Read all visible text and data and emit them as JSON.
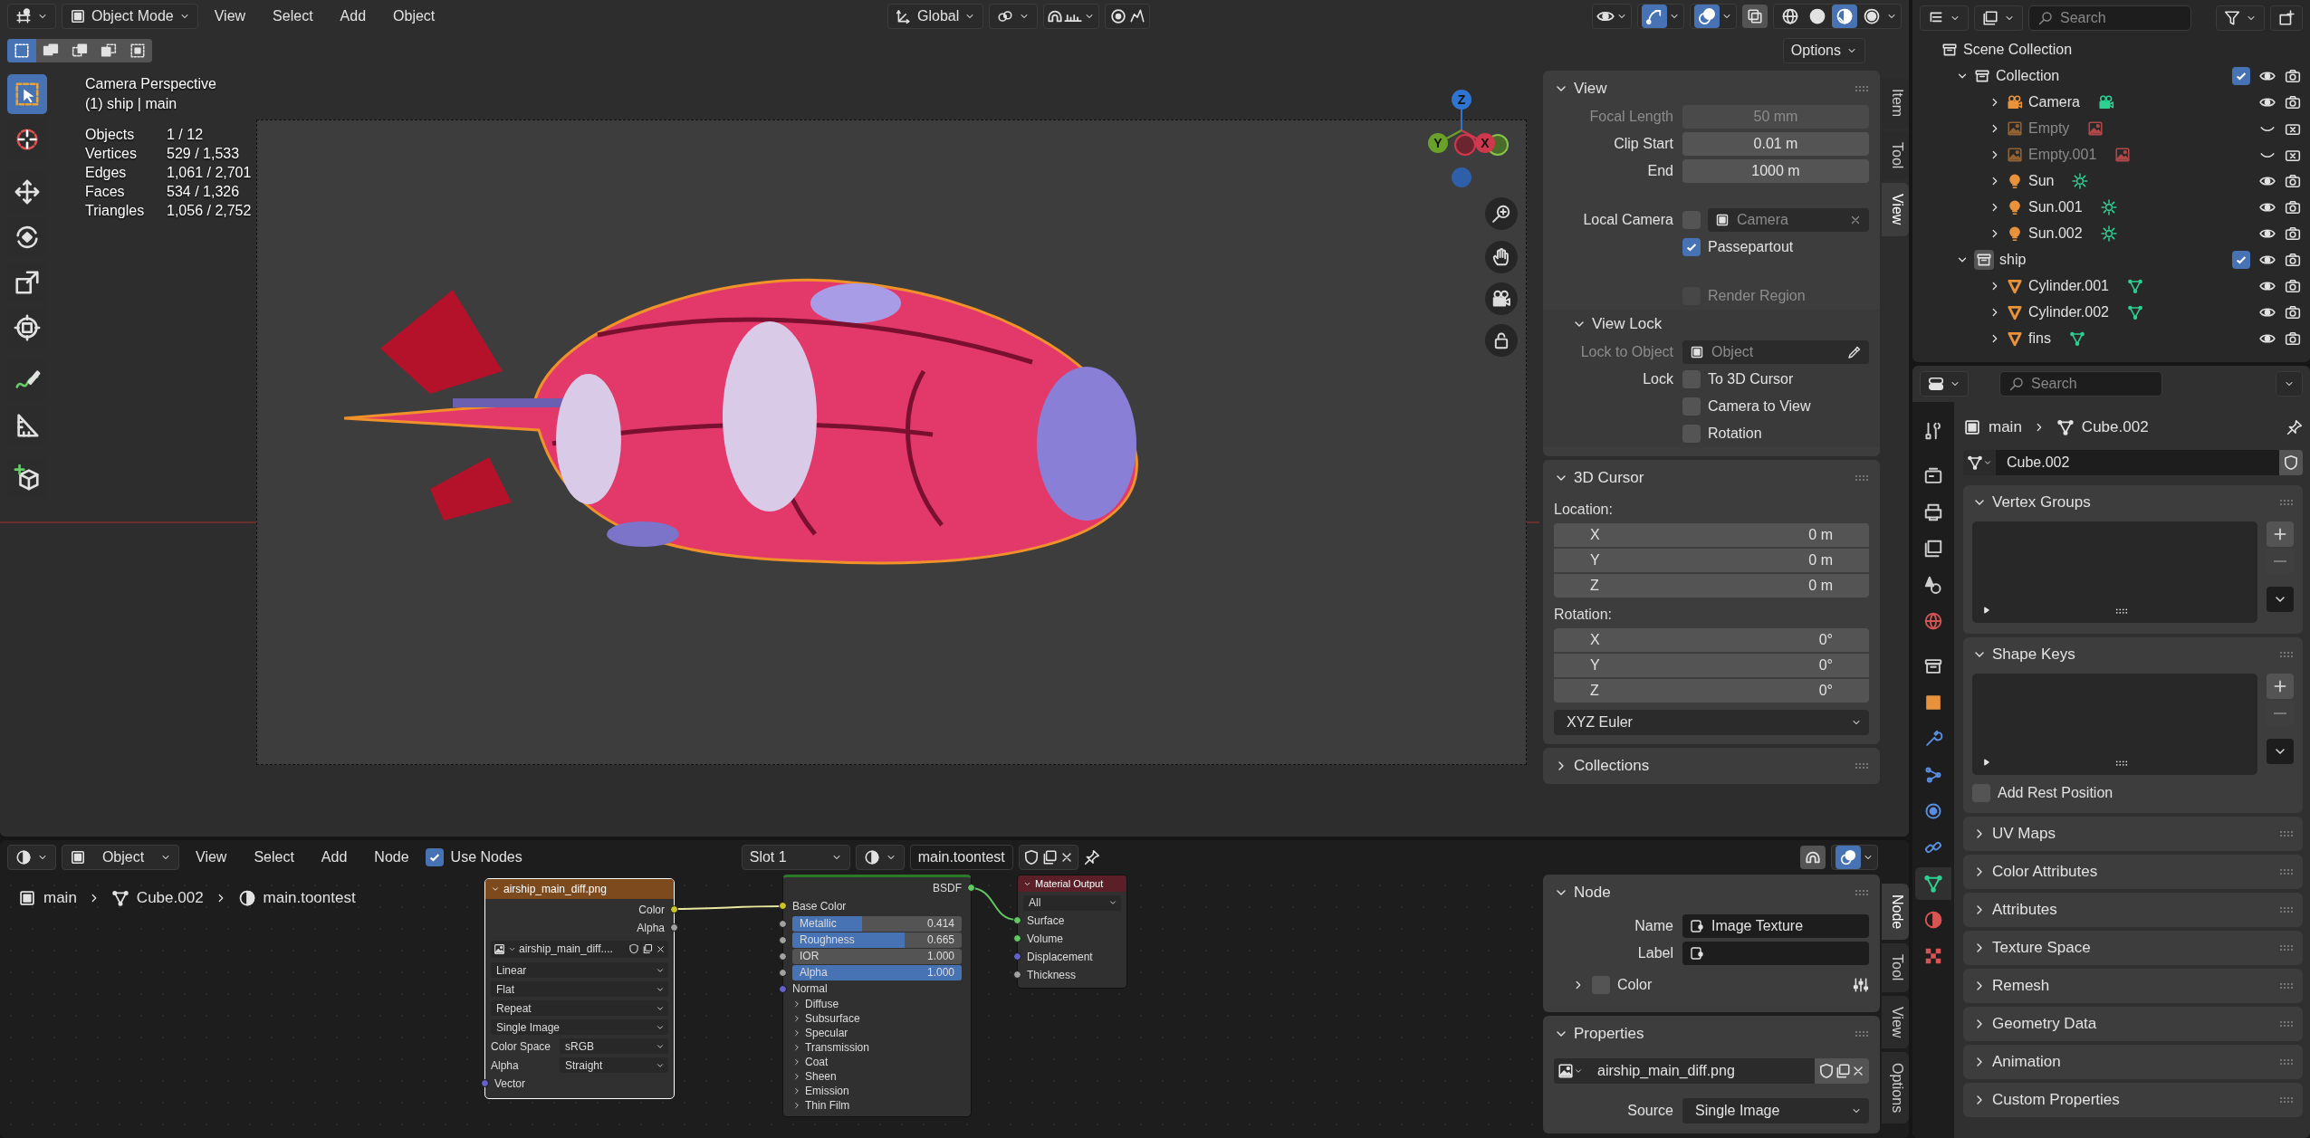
{
  "viewport": {
    "header": {
      "mode": "Object Mode",
      "menus": [
        "View",
        "Select",
        "Add",
        "Object"
      ],
      "orientation": "Global",
      "options": "Options"
    },
    "select_modes": [
      {
        "selected": true
      },
      {
        "selected": false
      },
      {
        "selected": false
      },
      {
        "selected": false
      },
      {
        "selected": false
      }
    ],
    "tools": [
      {
        "kind": "select",
        "selected": true
      },
      {
        "kind": "cursor",
        "selected": false
      },
      {
        "kind": "move",
        "selected": false
      },
      {
        "kind": "rotate",
        "selected": false
      },
      {
        "kind": "scale",
        "selected": false
      },
      {
        "kind": "transform",
        "selected": false
      },
      {
        "kind": "annotate",
        "selected": false
      },
      {
        "kind": "measure",
        "selected": false
      },
      {
        "kind": "add-cube",
        "selected": false
      }
    ],
    "overlay": {
      "title": "Camera Perspective",
      "subtitle": "(1) ship | main",
      "stats": [
        {
          "label": "Objects",
          "value": "1 / 12"
        },
        {
          "label": "Vertices",
          "value": "529 / 1,533"
        },
        {
          "label": "Edges",
          "value": "1,061 / 2,701"
        },
        {
          "label": "Faces",
          "value": "534 / 1,326"
        },
        {
          "label": "Triangles",
          "value": "1,056 / 2,752"
        }
      ]
    },
    "shading_modes": [
      {
        "selected": false
      },
      {
        "selected": false
      },
      {
        "selected": true
      },
      {
        "selected": false
      }
    ],
    "gizmo_axes": [
      {
        "label": "Z",
        "color": "#2f74d0"
      },
      {
        "label": "Y",
        "color": "#6aa229"
      },
      {
        "label": "X",
        "color": "#d0394d"
      }
    ],
    "sidebar": {
      "tabs": [
        {
          "label": "Item",
          "selected": false
        },
        {
          "label": "Tool",
          "selected": false
        },
        {
          "label": "View",
          "selected": true
        }
      ],
      "view_panel": {
        "title": "View",
        "expanded": true,
        "fields": [
          {
            "label": "Focal Length",
            "value": "50 mm",
            "disabled": true
          },
          {
            "label": "Clip Start",
            "value": "0.01 m",
            "disabled": false
          },
          {
            "label": "End",
            "value": "1000 m",
            "disabled": false
          }
        ],
        "local_camera": {
          "label": "Local Camera",
          "checked": false,
          "placeholder": "Camera"
        },
        "options": [
          {
            "label": "Passepartout",
            "checked": true,
            "disabled": false
          },
          {
            "label": "Render Region",
            "checked": false,
            "disabled": true
          }
        ],
        "lock": {
          "title": "View Lock",
          "expanded": true,
          "object_label": "Lock to Object",
          "object_placeholder": "Object",
          "lock_label": "Lock",
          "options": [
            {
              "label": "To 3D Cursor",
              "checked": false
            },
            {
              "label": "Camera to View",
              "checked": false
            },
            {
              "label": "Rotation",
              "checked": false
            }
          ]
        }
      },
      "cursor_panel": {
        "title": "3D Cursor",
        "expanded": true,
        "location_label": "Location:",
        "location": [
          {
            "axis": "X",
            "value": "0 m"
          },
          {
            "axis": "Y",
            "value": "0 m"
          },
          {
            "axis": "Z",
            "value": "0 m"
          }
        ],
        "rotation_label": "Rotation:",
        "rotation": [
          {
            "axis": "X",
            "value": "0°"
          },
          {
            "axis": "Y",
            "value": "0°"
          },
          {
            "axis": "Z",
            "value": "0°"
          }
        ],
        "mode": "XYZ Euler"
      },
      "collections_panel": {
        "title": "Collections",
        "expanded": false
      }
    }
  },
  "outliner": {
    "search_placeholder": "Search",
    "tree": [
      {
        "name": "Scene Collection",
        "kind": "scene",
        "children": [
          {
            "name": "Collection",
            "kind": "collection",
            "expanded": true,
            "checked": true,
            "selected": false,
            "visible": true,
            "children": [
              {
                "name": "Camera",
                "kind": "camera",
                "expanded": false,
                "visible": true
              },
              {
                "name": "Empty",
                "kind": "empty",
                "expanded": false,
                "visible": false
              },
              {
                "name": "Empty.001",
                "kind": "empty",
                "expanded": false,
                "visible": false
              },
              {
                "name": "Sun",
                "kind": "light",
                "expanded": false,
                "visible": true
              },
              {
                "name": "Sun.001",
                "kind": "light",
                "expanded": false,
                "visible": true
              },
              {
                "name": "Sun.002",
                "kind": "light",
                "expanded": false,
                "visible": true
              }
            ]
          },
          {
            "name": "ship",
            "kind": "collection",
            "expanded": true,
            "checked": true,
            "selected": true,
            "visible": true,
            "children": [
              {
                "name": "Cylinder.001",
                "kind": "mesh",
                "expanded": false,
                "visible": true
              },
              {
                "name": "Cylinder.002",
                "kind": "mesh",
                "expanded": false,
                "visible": true
              },
              {
                "name": "fins",
                "kind": "mesh",
                "expanded": false,
                "visible": true
              }
            ]
          }
        ]
      }
    ]
  },
  "properties": {
    "search_placeholder": "Search",
    "tabs": [
      {
        "kind": "tool",
        "selected": false
      },
      {
        "kind": "render",
        "selected": false
      },
      {
        "kind": "output",
        "selected": false
      },
      {
        "kind": "view-layer",
        "selected": false
      },
      {
        "kind": "scene",
        "selected": false
      },
      {
        "kind": "world",
        "selected": false
      },
      {
        "kind": "collection",
        "selected": false
      },
      {
        "kind": "object",
        "selected": false
      },
      {
        "kind": "modifiers",
        "selected": false
      },
      {
        "kind": "particles",
        "selected": false
      },
      {
        "kind": "physics",
        "selected": false
      },
      {
        "kind": "constraints",
        "selected": false
      },
      {
        "kind": "data",
        "selected": true
      },
      {
        "kind": "material",
        "selected": false
      },
      {
        "kind": "texture",
        "selected": false
      }
    ],
    "breadcrumb": [
      {
        "label": "main",
        "kind": "object"
      },
      {
        "label": "Cube.002",
        "kind": "mesh"
      }
    ],
    "datablock": "Cube.002",
    "panels": [
      {
        "title": "Vertex Groups",
        "expanded": true,
        "kind": "list"
      },
      {
        "title": "Shape Keys",
        "expanded": true,
        "kind": "list",
        "checkbox": {
          "label": "Add Rest Position",
          "checked": false
        }
      },
      {
        "title": "UV Maps",
        "expanded": false
      },
      {
        "title": "Color Attributes",
        "expanded": false
      },
      {
        "title": "Attributes",
        "expanded": false
      },
      {
        "title": "Texture Space",
        "expanded": false
      },
      {
        "title": "Remesh",
        "expanded": false
      },
      {
        "title": "Geometry Data",
        "expanded": false
      },
      {
        "title": "Animation",
        "expanded": false
      },
      {
        "title": "Custom Properties",
        "expanded": false
      }
    ]
  },
  "node_editor": {
    "header": {
      "object_mode": "Object",
      "menus": [
        "View",
        "Select",
        "Add",
        "Node"
      ],
      "use_nodes": {
        "label": "Use Nodes",
        "checked": true
      },
      "slot": "Slot 1",
      "material": "main.toontest"
    },
    "breadcrumb": [
      {
        "label": "main",
        "kind": "object"
      },
      {
        "label": "Cube.002",
        "kind": "mesh"
      },
      {
        "label": "main.toontest",
        "kind": "material"
      }
    ],
    "image_node": {
      "title": "airship_main_diff.png",
      "outputs": [
        {
          "label": "Color",
          "kind": "color"
        },
        {
          "label": "Alpha",
          "kind": "float"
        }
      ],
      "image": "airship_main_diff....",
      "dropdowns": [
        "Linear",
        "Flat",
        "Repeat",
        "Single Image"
      ],
      "settings": [
        {
          "label": "Color Space",
          "value": "sRGB"
        },
        {
          "label": "Alpha",
          "value": "Straight"
        }
      ],
      "inputs": [
        {
          "label": "Vector",
          "kind": "vector"
        }
      ]
    },
    "bsdf_node": {
      "output": "BSDF",
      "base_color": "Base Color",
      "sliders": [
        {
          "label": "Metallic",
          "value": "0.414",
          "level": 0.414
        },
        {
          "label": "Roughness",
          "value": "0.665",
          "level": 0.665
        },
        {
          "label": "IOR",
          "value": "1.000",
          "level": 0
        },
        {
          "label": "Alpha",
          "value": "1.000",
          "level": 1
        }
      ],
      "normal": "Normal",
      "panels": [
        "Diffuse",
        "Subsurface",
        "Specular",
        "Transmission",
        "Coat",
        "Sheen",
        "Emission",
        "Thin Film"
      ]
    },
    "output_node": {
      "title": "Material Output",
      "target": "All",
      "inputs": [
        {
          "label": "Surface",
          "kind": "shader"
        },
        {
          "label": "Volume",
          "kind": "shader"
        },
        {
          "label": "Displacement",
          "kind": "vector"
        },
        {
          "label": "Thickness",
          "kind": "float"
        }
      ]
    },
    "sidebar": {
      "tabs": [
        {
          "label": "Node",
          "selected": true
        },
        {
          "label": "Tool",
          "selected": false
        },
        {
          "label": "View",
          "selected": false
        },
        {
          "label": "Options",
          "selected": false
        }
      ],
      "node_panel": {
        "title": "Node",
        "expanded": true,
        "name_label": "Name",
        "name": "Image Texture",
        "label_label": "Label",
        "color": {
          "label": "Color",
          "checked": false
        }
      },
      "properties_panel": {
        "title": "Properties",
        "expanded": true,
        "image": "airship_main_diff.png",
        "source_label": "Source",
        "source": "Single Image"
      }
    }
  }
}
